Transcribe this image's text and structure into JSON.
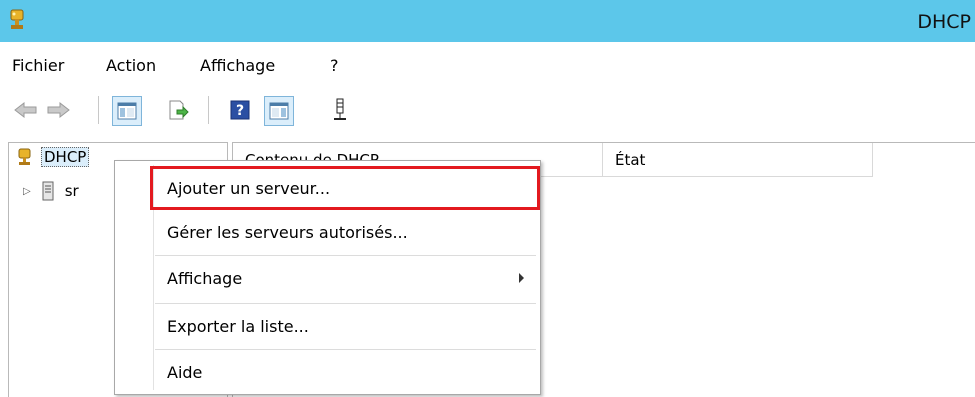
{
  "window": {
    "title": "DHCP"
  },
  "menubar": {
    "items": [
      "Fichier",
      "Action",
      "Affichage",
      "?"
    ]
  },
  "toolbar": {
    "buttons": [
      "back-arrow-icon",
      "forward-arrow-icon",
      "show-hide-console-tree-icon",
      "export-list-icon",
      "help-icon",
      "show-hide-action-pane-icon",
      "server-icon"
    ]
  },
  "tree": {
    "root_label": "DHCP",
    "child_label": "sr"
  },
  "list": {
    "columns": [
      "Contenu de DHCP",
      "État"
    ]
  },
  "context_menu": {
    "items": [
      {
        "label": "Ajouter un serveur..."
      },
      {
        "label": "Gérer les serveurs autorisés..."
      },
      {
        "label": "Affichage"
      },
      {
        "label": "Exporter la liste..."
      },
      {
        "label": "Aide"
      }
    ]
  },
  "colors": {
    "titlebar": "#5cc7ea",
    "highlight": "#e3191f"
  }
}
